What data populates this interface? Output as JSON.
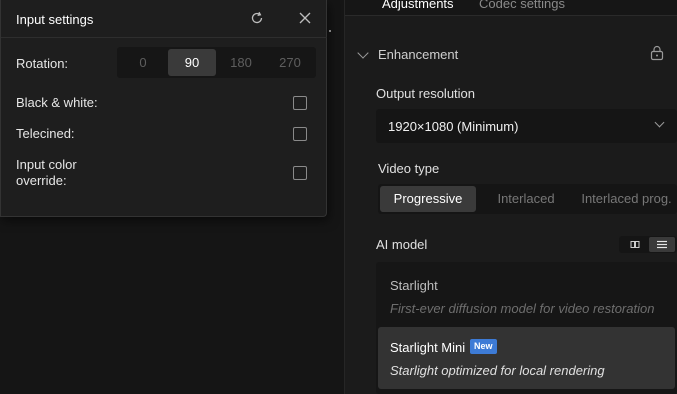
{
  "input_settings": {
    "title": "Input settings",
    "icons": {
      "refresh": "refresh-icon",
      "close": "close-icon"
    },
    "rotation": {
      "label": "Rotation:",
      "options": [
        "0",
        "90",
        "180",
        "270"
      ],
      "selected": "90"
    },
    "black_white": {
      "label": "Black & white:",
      "checked": false
    },
    "telecined": {
      "label": "Telecined:",
      "checked": false
    },
    "color_override": {
      "label_line1": "Input color",
      "label_line2": "override:",
      "checked": false
    }
  },
  "tabs": [
    {
      "label": "Adjustments",
      "active": true
    },
    {
      "label": "Codec settings",
      "active": false
    }
  ],
  "enhancement": {
    "title": "Enhancement",
    "expanded": true,
    "locked_icon": "lock-icon",
    "output_resolution": {
      "label": "Output resolution",
      "value": "1920×1080 (Minimum)"
    },
    "video_type": {
      "label": "Video type",
      "options": [
        "Progressive",
        "Interlaced",
        "Interlaced prog."
      ],
      "selected": "Progressive"
    },
    "ai_model": {
      "label": "AI model",
      "view_icons": [
        "grid-view-icon",
        "list-view-icon"
      ],
      "active_view": "list",
      "models": [
        {
          "name": "Starlight",
          "description": "First-ever diffusion model for video restoration",
          "selected": false,
          "badge": ""
        },
        {
          "name": "Starlight Mini",
          "description": "Starlight optimized for local rendering",
          "selected": true,
          "badge": "New"
        }
      ]
    }
  },
  "colors": {
    "accent_badge": "#3d7bd6",
    "background": "#1b1b1b",
    "selected": "#333333"
  }
}
